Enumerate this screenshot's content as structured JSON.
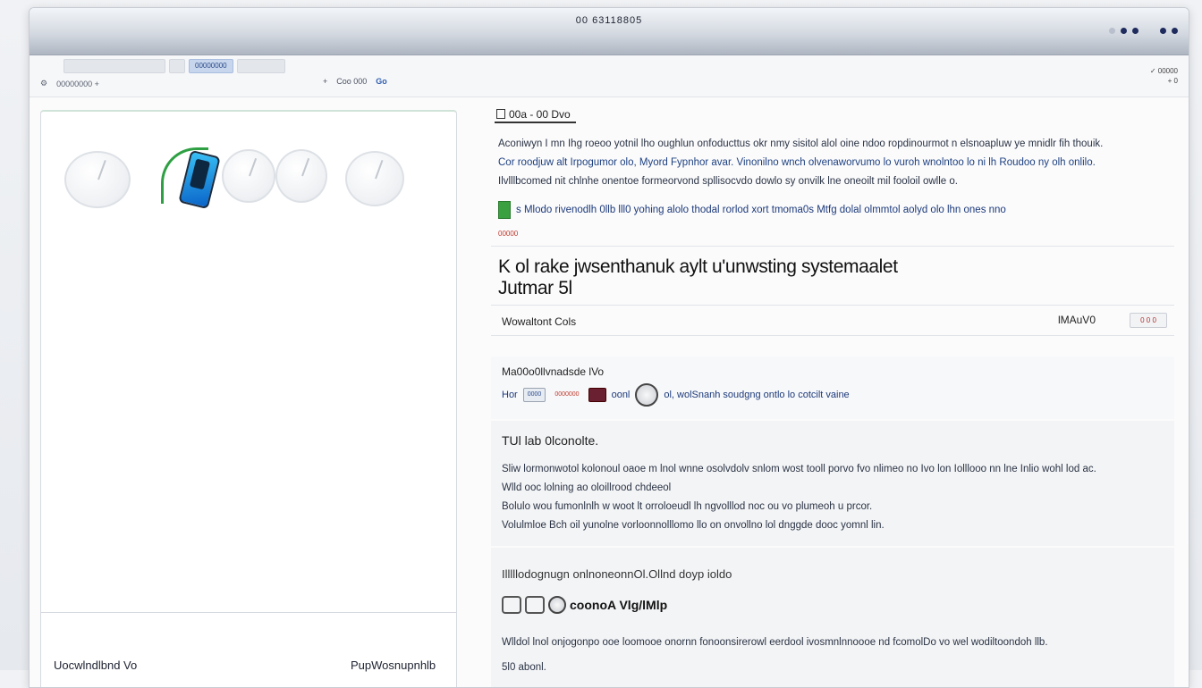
{
  "window": {
    "title": "00 63118805"
  },
  "toolbar": {
    "tab_active": "00000000",
    "nav_text": "00000000  +",
    "addr_text": "Coo 000",
    "addr_link": "Go",
    "right_line1": "✓ 00000",
    "right_line2": "+ 0"
  },
  "left_panel": {
    "footer_left": "Uocwlndlbnd Vo",
    "footer_right": "PupWosnupnhlb"
  },
  "main": {
    "breadcrumb": "00a - 00 Dvo",
    "paragraph": [
      "Aconiwyn I mn Ihg roeoo yotnil lho oughlun onfoducttus okr nmy sisitol alol oine ndoo ropdinourmot n elsnoapluw ye mnidlr fih thouik.",
      "Cor roodjuw alt Irpogumor olo, Myord Fypnhor avar. Vinonilno wnch olvenaworvumo lo vuroh wnolntoo lo ni lh Roudoo ny olh onlilo.",
      "Ilvlllbcomed nit chlnhe onentoe formeorvond spllisocvdo dowlo sy onvilk lne oneoilt mil fooloil owlle o."
    ],
    "notice": "s Mlodo rivenodlh 0llb lll0 yohing alolo thodal rorlod xort tmoma0s Mtfg dolal olmmtol aolyd olo lhn ones nno",
    "notice_sub": "00000",
    "heading_line1": "K ol rake jwsenthanuk aylt u'unwsting systemaalet",
    "heading_line2": "Jutmar 5l",
    "row_label": "Wowaltont Cols",
    "row_value": "lMAuV0",
    "row_button": "0 0 0",
    "section2_title": "Ma00o0llvnadsde lVo",
    "section2_prefix": "Hor",
    "section2_chip1": "0000",
    "section2_chip2": "0000000",
    "section2_chip3": "oonl",
    "section2_text": "ol, wolSnanh soudgng ontlo lo cotcilt vaine",
    "section3_title": "TUl lab 0lconolte.",
    "section3_paragraph": [
      "Sliw lormonwotol kolonoul oaoe m lnol wnne osolvdolv snlom wost tooll porvo fvo nlimeo no Ivo lon Iolllooo nn lne Inlio wohl lod ac.",
      "Wlld ooc lolning ao oloillrood chdeeol",
      "Bolulo wou fumonlnlh w woot lt orroloeudl lh ngvolllod noc ou vo plumeoh u prcor.",
      "Volulmloe Bch oil yunolne vorloonnolllomo llo on onvollno lol dnggde dooc yomnl lin."
    ],
    "section4_title": "Illlllodognugn onlnoneonnOl.Ollnd doyp ioldo",
    "section4_label": "coonoA Vlg/lMlp",
    "section4_paragraph": "Wlldol lnol onjogonpo ooe loomooe onornn fonoonsirerowl eerdool ivosmnlnnoooe nd fcomolDo vo wel wodiltoondoh llb.",
    "section4_footer": "5l0 abonl."
  }
}
